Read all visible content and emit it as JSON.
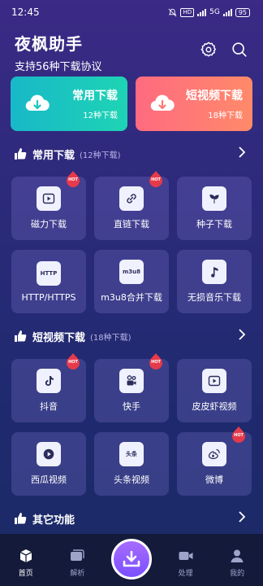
{
  "status": {
    "time": "12:45",
    "network": "HD",
    "network2": "5G",
    "battery": "95"
  },
  "header": {
    "title": "夜枫助手",
    "subtitle": "支持56种下载协议"
  },
  "big_cards": [
    {
      "title": "常用下载",
      "sub": "12种下载",
      "icon": "cloud-download-icon",
      "color": "#1cc6be"
    },
    {
      "title": "短视频下载",
      "sub": "18种下载",
      "icon": "cloud-download-icon",
      "color": "#ff7a75"
    }
  ],
  "sections": {
    "common": {
      "title": "常用下载",
      "count": "(12种下载)"
    },
    "short": {
      "title": "短视频下载",
      "count": "(18种下载)"
    },
    "other": {
      "title": "其它功能"
    }
  },
  "common_tiles": [
    {
      "label": "磁力下载",
      "icon": "play-square-icon",
      "hot": true
    },
    {
      "label": "直链下载",
      "icon": "link-icon",
      "hot": true
    },
    {
      "label": "种子下载",
      "icon": "sprout-icon",
      "hot": false
    },
    {
      "label": "HTTP/HTTPS",
      "icon": "http-icon",
      "icon_text": "HTTP",
      "hot": false
    },
    {
      "label": "m3u8合并下载",
      "icon": "m3u8-icon",
      "icon_text": "m3u8",
      "hot": false
    },
    {
      "label": "无损音乐下载",
      "icon": "music-note-icon",
      "hot": false
    }
  ],
  "short_tiles": [
    {
      "label": "抖音",
      "icon": "douyin-icon",
      "hot": true
    },
    {
      "label": "快手",
      "icon": "kuaishou-icon",
      "hot": true
    },
    {
      "label": "皮皮虾视频",
      "icon": "play-square-icon",
      "hot": false
    },
    {
      "label": "西瓜视频",
      "icon": "play-circle-icon",
      "hot": false
    },
    {
      "label": "头条视频",
      "icon": "toutiao-icon",
      "icon_text": "头条",
      "hot": false
    },
    {
      "label": "微博",
      "icon": "weibo-icon",
      "hot": true
    }
  ],
  "hot_label": "HOT",
  "nav": [
    {
      "label": "首页",
      "icon": "home-cube-icon",
      "active": true
    },
    {
      "label": "解析",
      "icon": "cards-icon",
      "active": false
    },
    {
      "label": "处理",
      "icon": "video-camera-icon",
      "active": false
    },
    {
      "label": "我的",
      "icon": "user-icon",
      "active": false
    }
  ],
  "colors": {
    "accent": "#8a5cff",
    "hot": "#e63a4a"
  }
}
